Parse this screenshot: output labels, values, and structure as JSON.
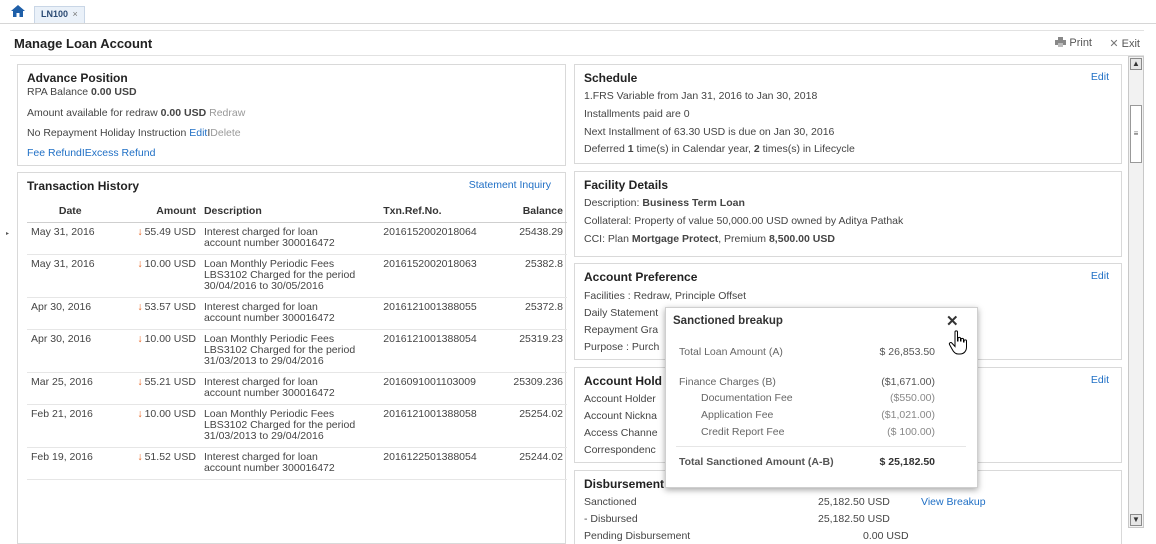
{
  "tab": {
    "label": "LN100",
    "close": "×"
  },
  "header": {
    "title": "Manage Loan Account",
    "print": "Print",
    "exit": "Exit"
  },
  "advance": {
    "title": "Advance Position",
    "rpa_label": "RPA Balance ",
    "rpa_value": "0.00 USD",
    "redraw_label": "Amount available for redraw ",
    "redraw_value": "0.00 USD",
    "redraw_link": "Redraw",
    "holiday_text": "No Repayment Holiday Instruction ",
    "edit": "Edit",
    "sep": "I",
    "delete": "Delete",
    "fee_refund": "Fee Refund",
    "excess_refund": "Excess Refund"
  },
  "txn": {
    "title": "Transaction History",
    "statement": "Statement Inquiry",
    "headers": {
      "date": "Date",
      "amount": "Amount",
      "desc": "Description",
      "ref": "Txn.Ref.No.",
      "balance": "Balance"
    },
    "rows": [
      {
        "date": "May 31, 2016",
        "amount": "55.49 USD",
        "desc1": "Interest charged for loan",
        "desc2": "account number 300016472",
        "desc3": "",
        "ref": "2016152002018064",
        "balance": "25438.29"
      },
      {
        "date": "May 31, 2016",
        "amount": "10.00 USD",
        "desc1": "Loan Monthly Periodic Fees",
        "desc2": "LBS3102 Charged for the period",
        "desc3": "30/04/2016 to 30/05/2016",
        "ref": "2016152002018063",
        "balance": "25382.8"
      },
      {
        "date": "Apr 30, 2016",
        "amount": "53.57 USD",
        "desc1": "Interest charged for loan",
        "desc2": "account number 300016472",
        "desc3": "",
        "ref": "2016121001388055",
        "balance": "25372.8"
      },
      {
        "date": "Apr 30, 2016",
        "amount": "10.00 USD",
        "desc1": "Loan Monthly Periodic Fees",
        "desc2": "LBS3102 Charged for the period",
        "desc3": "31/03/2013 to 29/04/2016",
        "ref": "2016121001388054",
        "balance": "25319.23"
      },
      {
        "date": "Mar 25, 2016",
        "amount": "55.21 USD",
        "desc1": "Interest charged for loan",
        "desc2": "account number 300016472",
        "desc3": "",
        "ref": "2016091001103009",
        "balance": "25309.236"
      },
      {
        "date": "Feb 21, 2016",
        "amount": "10.00 USD",
        "desc1": "Loan Monthly Periodic Fees",
        "desc2": "LBS3102 Charged for the period",
        "desc3": "31/03/2013 to 29/04/2016",
        "ref": "2016121001388058",
        "balance": "25254.02"
      },
      {
        "date": "Feb 19, 2016",
        "amount": "51.52 USD",
        "desc1": "Interest charged for loan",
        "desc2": "account number 300016472",
        "desc3": "",
        "ref": "2016122501388054",
        "balance": "25244.02"
      }
    ]
  },
  "schedule": {
    "title": "Schedule",
    "edit": "Edit",
    "l1": "1.FRS Variable from Jan 31, 2016 to Jan 30, 2018",
    "l2": "Installments paid are 0",
    "l3": "Next Installment of 63.30 USD is due on Jan 30, 2016",
    "l4a": "Deferred ",
    "l4b": "1",
    "l4c": " time(s) in Calendar year, ",
    "l4d": "2",
    "l4e": " times(s) in Lifecycle"
  },
  "facility": {
    "title": "Facility Details",
    "desc_label": "Description: ",
    "desc_value": "Business Term Loan",
    "collateral": "Collateral: Property of value 50,000.00 USD owned by Aditya Pathak",
    "cci_a": "CCI: Plan ",
    "cci_b": "Mortgage Protect",
    "cci_c": ", Premium ",
    "cci_d": "8,500.00 USD"
  },
  "preference": {
    "title": "Account Preference",
    "edit": "Edit",
    "l1": "Facilities : Redraw, Principle Offset",
    "l2": "Daily Statement",
    "l3": "Repayment Gra",
    "l4": "Purpose : Purch"
  },
  "holder": {
    "title": "Account Hold",
    "edit": "Edit",
    "l1": "Account Holder",
    "l2": "Account Nickna",
    "l3": "Access Channe",
    "l4": "Correspondenc"
  },
  "disbursement": {
    "title": "Disbursement",
    "sanctioned_label": "Sanctioned",
    "sanctioned_value": "25,182.50 USD",
    "view_breakup": "View Breakup",
    "disbursed_label": "-    Disbursed",
    "disbursed_value": "25,182.50 USD",
    "pending_label": "Pending Disbursement",
    "pending_value": "0.00 USD"
  },
  "popup": {
    "title": "Sanctioned  breakup",
    "close": "✕",
    "total_loan_label": "Total Loan Amount (A)",
    "total_loan_value": "$ 26,853.50",
    "finance_label": "Finance Charges (B)",
    "finance_value": "($1,671.00)",
    "doc_label": "Documentation Fee",
    "doc_value": "($550.00)",
    "app_label": "Application Fee",
    "app_value": "($1,021.00)",
    "credit_label": "Credit Report Fee",
    "credit_value": "($ 100.00)",
    "sanctioned_label": "Total Sanctioned Amount (A-B)",
    "sanctioned_value": "$ 25,182.50"
  }
}
